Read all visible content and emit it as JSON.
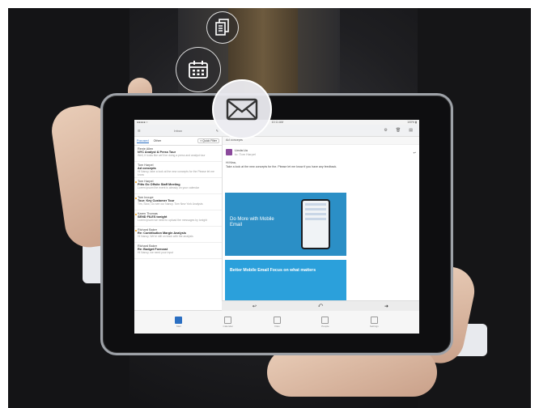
{
  "screen": {
    "status": {
      "left": "●●●●● ≈",
      "time": "10:11 AM",
      "battery": "100% ▮"
    },
    "list_title": "Inbox",
    "tabs": [
      "Focused",
      "Other"
    ],
    "filter_label": "≡ Quick Filter",
    "mails": [
      {
        "from": "Renie Allen",
        "subject": "NYC Analyst & Press Tour",
        "preview": "Well, it looks like we'll be doing a press and analyst tour",
        "unread": false
      },
      {
        "from": "Tom Harpel",
        "subject": "Ad concepts",
        "preview": "Hi Nancy, take a look at the new concepts for the Please let me know",
        "unread": false
      },
      {
        "from": "Tom Harpel",
        "subject": "Pitts Go Offsite Staff Meeting",
        "preview": "Lorem ipsum the event is already on your calendar",
        "unread": true
      },
      {
        "from": "Tom Inouye",
        "subject": "Tour: Key Customer Tour",
        "preview": "Tim, Slow, Go see our Nancy. Tom New York Analysts",
        "unread": true
      },
      {
        "from": "Karen Thomas",
        "subject": "SEND FILES tonight",
        "preview": "Lorem ipsum we need to upload the messages by tonight",
        "unread": true
      },
      {
        "from": "Richard Baker",
        "subject": "Re: Contribution Margin Analysis",
        "preview": "Hi Nancy, We're still on track with the analysis",
        "unread": true
      },
      {
        "from": "Richard Baker",
        "subject": "Re: Budget Forecast",
        "preview": "Hi Nancy, we need your input",
        "unread": false
      }
    ],
    "reader": {
      "folder": "Ad concepts",
      "sender": "Linda Liu",
      "to_line": "to: Tom Harpel",
      "greeting": "Hi Nina,",
      "body": "Take a look at the new concepts for the. Please let me know if you have any feedback.",
      "banner1_text": "Do More with Mobile Email",
      "banner2_text": "Better Mobile Email Focus on what matters"
    },
    "dock": [
      "Mail",
      "Calendar",
      "Files",
      "People",
      "Settings"
    ]
  },
  "bubbles": [
    "document-icon",
    "calendar-icon",
    "mail-icon"
  ],
  "colors": {
    "accent": "#2b6fc2",
    "banner": "#2b8fc6",
    "unread_dot": "#f2a31a"
  }
}
